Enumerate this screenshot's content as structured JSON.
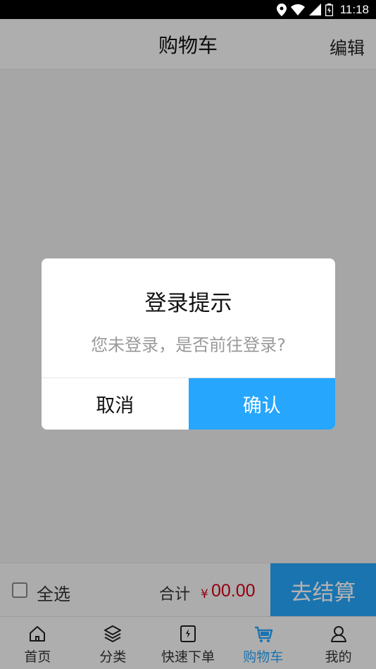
{
  "status_bar": {
    "time": "11:18",
    "icons": [
      "location-icon",
      "wifi-icon",
      "signal-icon",
      "battery-icon"
    ]
  },
  "header": {
    "title": "购物车",
    "edit_label": "编辑"
  },
  "checkout": {
    "select_all_label": "全选",
    "total_label": "合计",
    "currency_symbol": "¥",
    "total_value": "00.00",
    "checkout_label": "去结算"
  },
  "tabbar": {
    "items": [
      {
        "label": "首页",
        "icon": "home-icon"
      },
      {
        "label": "分类",
        "icon": "layers-icon"
      },
      {
        "label": "快速下单",
        "icon": "quick-order-icon"
      },
      {
        "label": "购物车",
        "icon": "cart-icon",
        "active": true
      },
      {
        "label": "我的",
        "icon": "user-icon"
      }
    ]
  },
  "dialog": {
    "title": "登录提示",
    "message": "您未登录，是否前往登录?",
    "cancel_label": "取消",
    "confirm_label": "确认"
  },
  "colors": {
    "accent": "#26a6fd",
    "price": "#d0021b"
  }
}
